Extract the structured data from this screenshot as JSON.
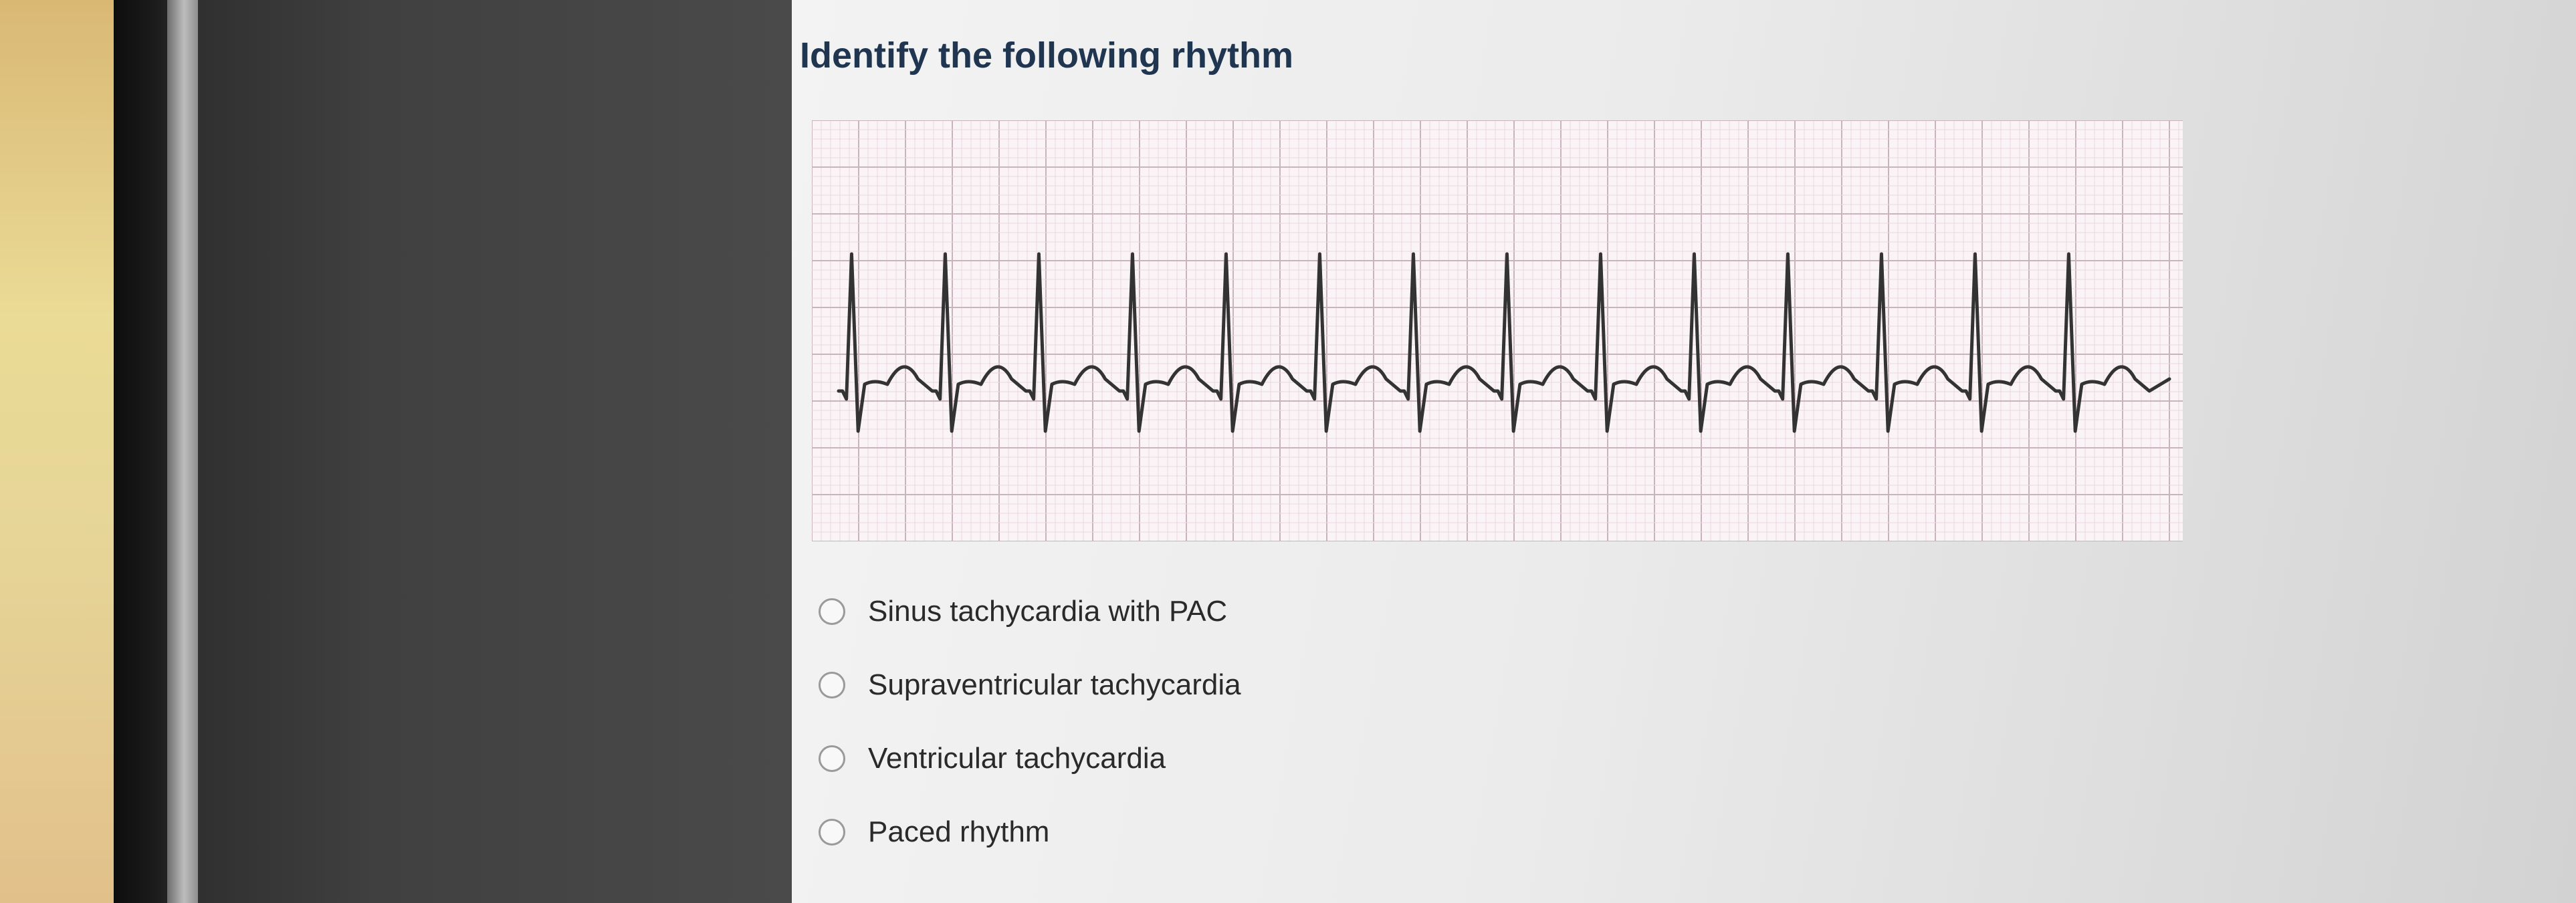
{
  "question": {
    "title": "Identify the following rhythm"
  },
  "ecg": {
    "image_label": "ECG rhythm strip",
    "beat_count": 14
  },
  "options": [
    {
      "label": "Sinus tachycardia with PAC",
      "selected": false
    },
    {
      "label": "Supraventricular tachycardia",
      "selected": false
    },
    {
      "label": "Ventricular tachycardia",
      "selected": false
    },
    {
      "label": "Paced rhythm",
      "selected": false
    }
  ],
  "colors": {
    "title": "#1f3550",
    "grid_minor": "#ead8e0",
    "grid_major": "#c9b3bd",
    "trace": "#333333"
  }
}
